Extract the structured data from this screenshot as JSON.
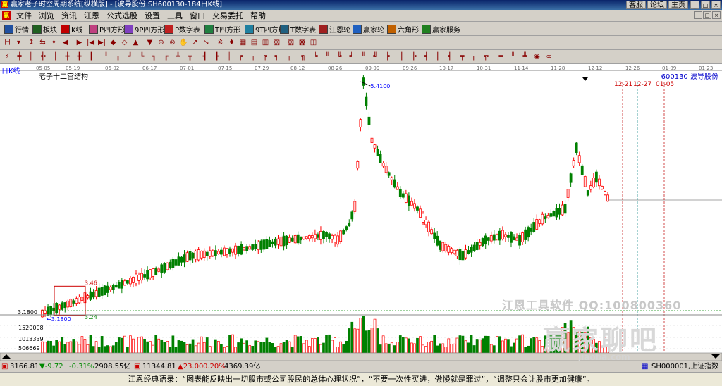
{
  "window": {
    "app_icon": "赢",
    "title": "赢家老子时空周期系统[纵横版] - [波导股份  SH600130-184日K线]",
    "right_links": [
      "客服",
      "论坛",
      "主页"
    ],
    "win_buttons": [
      "_",
      "□",
      "×"
    ]
  },
  "menu": {
    "icon": "赢",
    "items": [
      "文件",
      "浏览",
      "资讯",
      "江恩",
      "公式选股",
      "设置",
      "工具",
      "窗口",
      "交易委托",
      "帮助"
    ],
    "mdi_buttons": [
      "_",
      "□",
      "×"
    ]
  },
  "toolbar_main": [
    {
      "icon": "grid-icon",
      "label": "行情",
      "color": "#2050a0"
    },
    {
      "icon": "blocks-icon",
      "label": "板块",
      "color": "#206020"
    },
    {
      "icon": "kline-icon",
      "label": "K线",
      "color": "#c00000"
    },
    {
      "icon": "p-square-icon",
      "label": "P四方形",
      "color": "#c04080"
    },
    {
      "icon": "9p-square-icon",
      "label": "9P四方形",
      "color": "#8040c0"
    },
    {
      "icon": "p-table-icon",
      "label": "P数字表",
      "color": "#c02020"
    },
    {
      "icon": "t-square-icon",
      "label": "T四方形",
      "color": "#208040"
    },
    {
      "icon": "9t-square-icon",
      "label": "9T四方形",
      "color": "#2080a0"
    },
    {
      "icon": "t-table-icon",
      "label": "T数字表",
      "color": "#206080"
    },
    {
      "icon": "gann-wheel-icon",
      "label": "江恩轮",
      "color": "#a02020"
    },
    {
      "icon": "winner-wheel-icon",
      "label": "赢家轮",
      "color": "#2060c0"
    },
    {
      "icon": "hexagram-icon",
      "label": "六角形",
      "color": "#c06000"
    },
    {
      "icon": "service-icon",
      "label": "赢家服务",
      "color": "#208020"
    }
  ],
  "status": {
    "sh_index": "3166.81",
    "sh_change": "▼-9.72",
    "sh_pct": "-0.31%",
    "sh_volume": "2908.55亿",
    "sz_index": "11344.81",
    "sz_change": "▲23.00",
    "sz_pct": "0.20%",
    "sz_volume": "4369.39亿",
    "current_index": "SH000001,上证指数"
  },
  "quote_bar": "江恩经典语录：“图表能反映出一切股市或公司股民的总体心理状况”，“不要一次性买进，傲慢就是罪过”，“调整只会让股市更加健康”。",
  "chart_data": {
    "type": "candlestick",
    "period_label": "日K线",
    "indicator_title": "老子十二宫结构",
    "stock_code": "600130",
    "stock_name": "波导股份",
    "x_ticks": [
      "05-05",
      "05-19",
      "06-02",
      "06-17",
      "07-01",
      "07-15",
      "07-29",
      "08-12",
      "08-26",
      "09-09",
      "09-26",
      "10-17",
      "10-31",
      "11-14",
      "11-28",
      "12-12",
      "12-26",
      "01-09",
      "01-23"
    ],
    "future_date_labels": [
      "12-21",
      "12-27",
      "01-05"
    ],
    "annotations": {
      "high_price": "5.4100",
      "low_price": "3.1800",
      "box_top": "3.46",
      "box_bottom": "3.24",
      "low_line": "3.1800",
      "left_axis_low": "3.1800"
    },
    "volume_axis_labels": [
      "1520008",
      "1013339",
      "506669"
    ],
    "watermarks": {
      "brand": "江恩工具软件  QQ:100800360",
      "forum": "赢家聊吧",
      "url": "jiaoba.com"
    },
    "colors": {
      "up": "#ff0000",
      "down": "#008000",
      "date_line_red": "#c00000",
      "date_line_green": "#008080"
    }
  }
}
